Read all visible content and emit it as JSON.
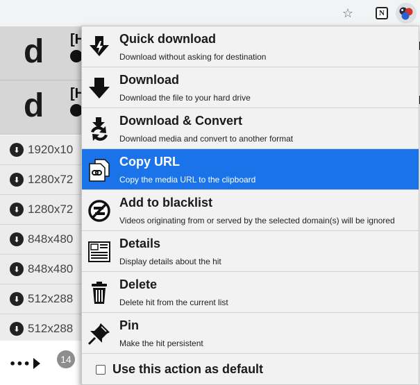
{
  "toolbar": {
    "star_glyph": "☆",
    "notion_glyph": "N"
  },
  "background": {
    "hit_headers": [
      {
        "logo": "d",
        "fragment": "[H"
      },
      {
        "logo": "d",
        "fragment": "[H"
      }
    ],
    "variants": [
      {
        "label": "1920x10"
      },
      {
        "label": "1280x72"
      },
      {
        "label": "1280x72"
      },
      {
        "label": "848x480"
      },
      {
        "label": "848x480"
      },
      {
        "label": "512x288"
      },
      {
        "label": "512x288"
      }
    ],
    "more_label": "•••",
    "hit_count": "14"
  },
  "menu": {
    "items": [
      {
        "title": "Quick download",
        "desc": "Download without asking for destination",
        "icon": "quick-download-icon"
      },
      {
        "title": "Download",
        "desc": "Download the file to your hard drive",
        "icon": "download-icon"
      },
      {
        "title": "Download & Convert",
        "desc": "Download media and convert to another format",
        "icon": "download-convert-icon"
      },
      {
        "title": "Copy URL",
        "desc": "Copy the media URL to the clipboard",
        "icon": "copy-url-icon",
        "selected": true
      },
      {
        "title": "Add to blacklist",
        "desc": "Videos originating from or served by the selected domain(s) will be ignored",
        "icon": "blacklist-icon"
      },
      {
        "title": "Details",
        "desc": "Display details about the hit",
        "icon": "details-icon"
      },
      {
        "title": "Delete",
        "desc": "Delete hit from the current list",
        "icon": "trash-icon"
      },
      {
        "title": "Pin",
        "desc": "Make the hit persistent",
        "icon": "pin-icon"
      }
    ],
    "default_action_label": "Use this action as default",
    "default_action_checked": false
  },
  "colors": {
    "selected_bg": "#1a73e8",
    "menu_bg": "#f2f2f2"
  }
}
